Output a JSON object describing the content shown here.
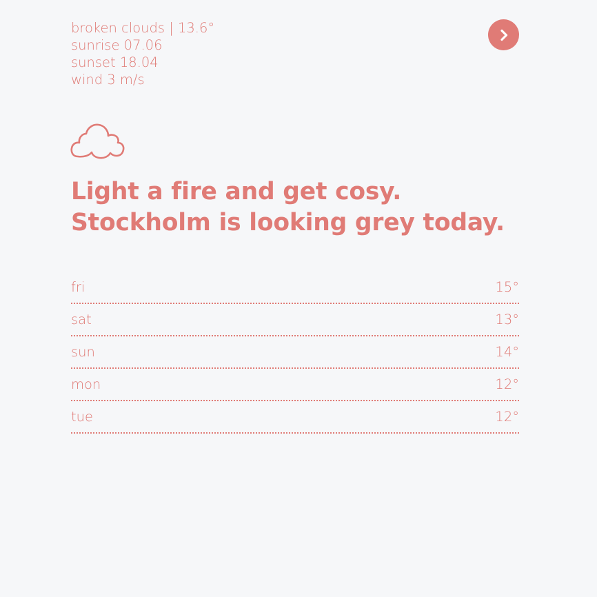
{
  "current": {
    "conditions": "broken clouds | 13.6°",
    "sunrise": "sunrise 07.06",
    "sunset": "sunset 18.04",
    "wind": "wind 3 m/s"
  },
  "icons": {
    "next": "chevron-right-icon",
    "weather": "cloud-icon"
  },
  "headline": {
    "line1": "Light a fire and get cosy.",
    "line2": "Stockholm is looking grey today."
  },
  "forecast": [
    {
      "day": "fri",
      "temp": "15°"
    },
    {
      "day": "sat",
      "temp": "13°"
    },
    {
      "day": "sun",
      "temp": "14°"
    },
    {
      "day": "mon",
      "temp": "12°"
    },
    {
      "day": "tue",
      "temp": "12°"
    }
  ],
  "colors": {
    "accent": "#e07b76",
    "background": "#f6f7f9"
  }
}
